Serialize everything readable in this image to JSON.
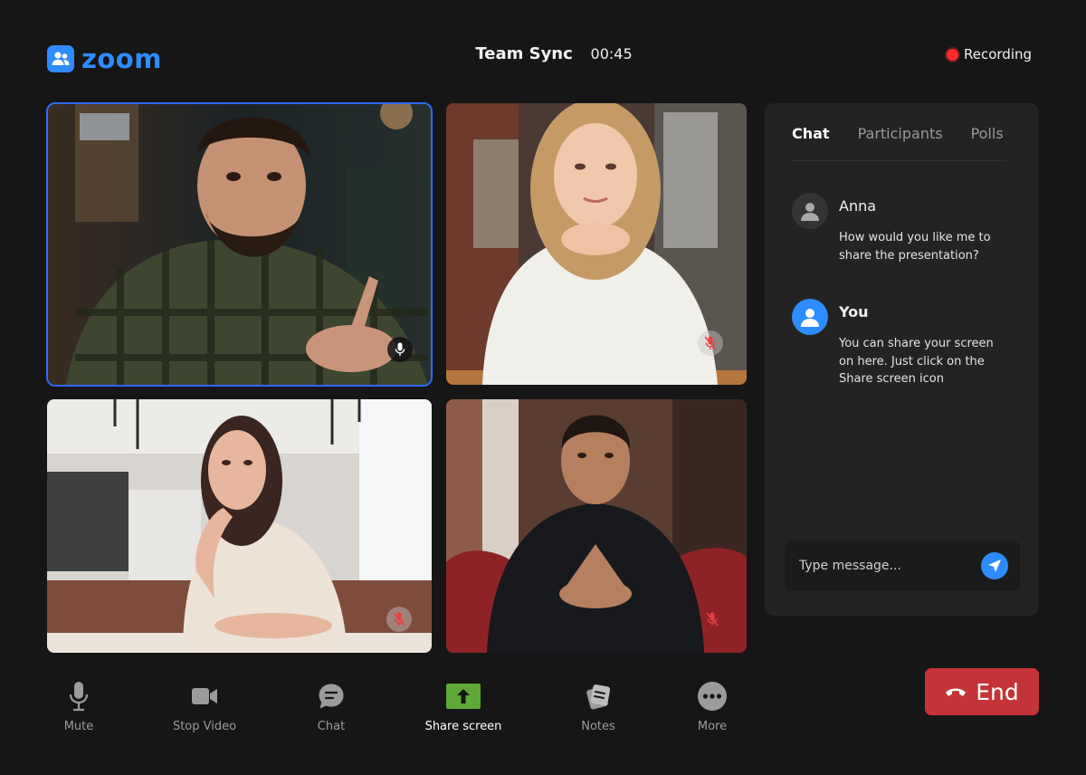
{
  "app": {
    "name": "zoom"
  },
  "meeting": {
    "title": "Team Sync",
    "timer": "00:45"
  },
  "recording": {
    "label": "Recording",
    "color": "#ff2a2a"
  },
  "tiles": [
    {
      "participant": "speaker-man-plaid-shirt",
      "mic": "on",
      "active": true
    },
    {
      "participant": "woman-white-blouse",
      "mic": "muted",
      "active": false
    },
    {
      "participant": "woman-beige-top",
      "mic": "muted",
      "active": false
    },
    {
      "participant": "man-black-shirt",
      "mic": "muted",
      "active": false
    }
  ],
  "panel": {
    "tabs": [
      {
        "label": "Chat",
        "active": true
      },
      {
        "label": "Participants",
        "active": false
      },
      {
        "label": "Polls",
        "active": false
      }
    ],
    "messages": [
      {
        "sender": "Anna",
        "text": "How would you like me to share the presentation?"
      },
      {
        "sender": "You",
        "text": "You can share your screen on here. Just click on the Share screen icon"
      }
    ],
    "composer": {
      "placeholder": "Type message..."
    }
  },
  "toolbar": {
    "items": [
      {
        "label": "Mute",
        "icon": "microphone-icon"
      },
      {
        "label": "Stop Video",
        "icon": "video-camera-icon"
      },
      {
        "label": "Chat",
        "icon": "chat-bubble-icon"
      },
      {
        "label": "Share screen",
        "icon": "share-screen-icon",
        "highlight": true
      },
      {
        "label": "Notes",
        "icon": "notes-icon"
      },
      {
        "label": "More",
        "icon": "more-dots-icon"
      }
    ],
    "end_label": "End"
  },
  "colors": {
    "accent": "#2d8cff",
    "end": "#c43437",
    "background": "#161616",
    "panel": "#232323",
    "share": "#5fa83a"
  }
}
